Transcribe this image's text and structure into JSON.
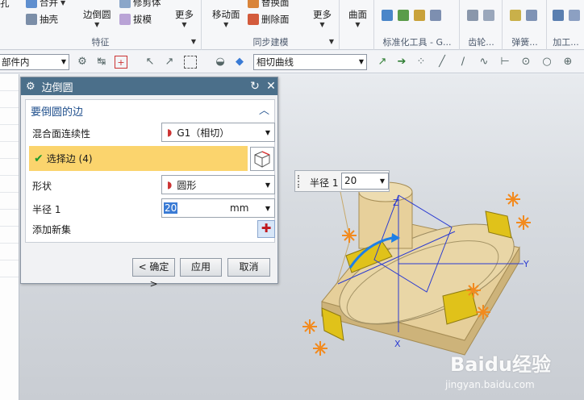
{
  "ribbon": {
    "groups": [
      {
        "label": "特征",
        "items": [
          "合并",
          "抽壳",
          "边倒圆",
          "修剪体",
          "拔模",
          "更多"
        ]
      },
      {
        "label": "同步建模",
        "items": [
          "移动面",
          "替换面",
          "删除面",
          "更多"
        ]
      },
      {
        "label": "",
        "items": [
          "曲面"
        ]
      },
      {
        "label": "标准化工具 - G...",
        "items": []
      },
      {
        "label": "齿轮...",
        "items": []
      },
      {
        "label": "弹簧...",
        "items": []
      },
      {
        "label": "加工...",
        "items": []
      }
    ],
    "left_cut_label": "孔"
  },
  "toolbar": {
    "filter_select": "部件内",
    "curve_rule": "相切曲线"
  },
  "dialog": {
    "title": "边倒圆",
    "section_title": "要倒圆的边",
    "continuity_label": "混合面连续性",
    "continuity_value": "G1（相切）",
    "select_edge_label": "选择边 (4)",
    "shape_label": "形状",
    "shape_value": "圆形",
    "radius_label": "半径 1",
    "radius_value": "20",
    "radius_unit": "mm",
    "add_set_label": "添加新集",
    "ok_label": "< 确定 >",
    "apply_label": "应用",
    "cancel_label": "取消"
  },
  "float_input": {
    "label": "半径 1",
    "value": "20"
  },
  "axes": {
    "x": "X",
    "y": "Y",
    "z": "Z"
  },
  "watermark": {
    "brand": "Baidu经验",
    "url": "jingyan.baidu.com"
  },
  "colors": {
    "title_bar": "#4b6f8a",
    "selection_highlight": "#fbd46d",
    "part_body": "#e6cf9a",
    "fillet_face": "#e0c21a",
    "marker": "#f28a1e"
  }
}
